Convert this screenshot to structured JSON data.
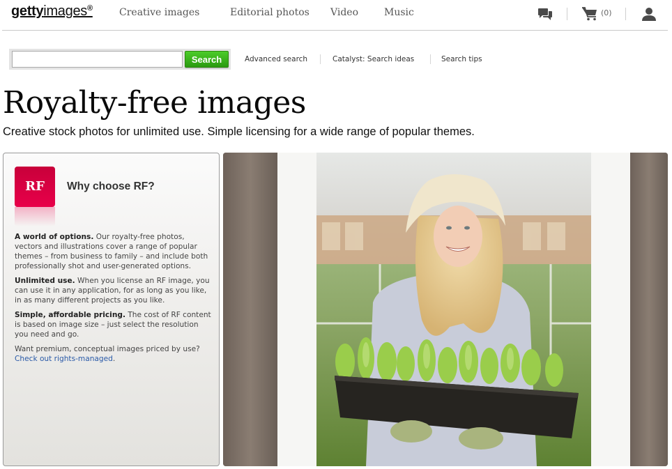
{
  "header": {
    "logo": {
      "bold": "getty",
      "regular": "images",
      "mark": "®"
    },
    "nav": [
      {
        "label": "Creative images"
      },
      {
        "label": "Editorial photos"
      },
      {
        "label": "Video"
      },
      {
        "label": "Music"
      }
    ],
    "utility": {
      "chat_icon": "chat-bubbles-icon",
      "cart_icon": "shopping-cart-icon",
      "cart_count": "(0)",
      "user_icon": "user-icon"
    }
  },
  "search": {
    "query": "",
    "placeholder": "",
    "button_label": "Search",
    "links": [
      {
        "label": "Advanced search"
      },
      {
        "label": "Catalyst: Search ideas"
      },
      {
        "label": "Search tips"
      }
    ]
  },
  "page": {
    "title": "Royalty-free images",
    "subtitle": "Creative stock photos for unlimited use. Simple licensing for a wide range of popular themes."
  },
  "panel": {
    "badge": "RF",
    "title": "Why choose RF?",
    "sections": [
      {
        "heading": "A world of options.",
        "text": " Our royalty-free photos, vectors and illustrations cover a range of popular themes – from business to family – and include both professionally shot and user-generated options."
      },
      {
        "heading": "Unlimited use.",
        "text": " When you license an RF image, you can use it in any application, for as long as you like, in as many different projects as you like."
      },
      {
        "heading": "Simple, affordable pricing.",
        "text": " The cost of RF content is based on image size – just select the resolution you need and go."
      }
    ],
    "footer_text": "Want premium, conceptual images priced by use? ",
    "footer_link": "Check out rights-managed",
    "footer_end": "."
  },
  "hero": {
    "description": "Smiling woman in sun hat holding a tray of lettuce seedlings in a greenhouse doorway"
  },
  "colors": {
    "search_green": "#34b01a",
    "rf_red": "#e0004a",
    "link_blue": "#2a5aa8"
  }
}
